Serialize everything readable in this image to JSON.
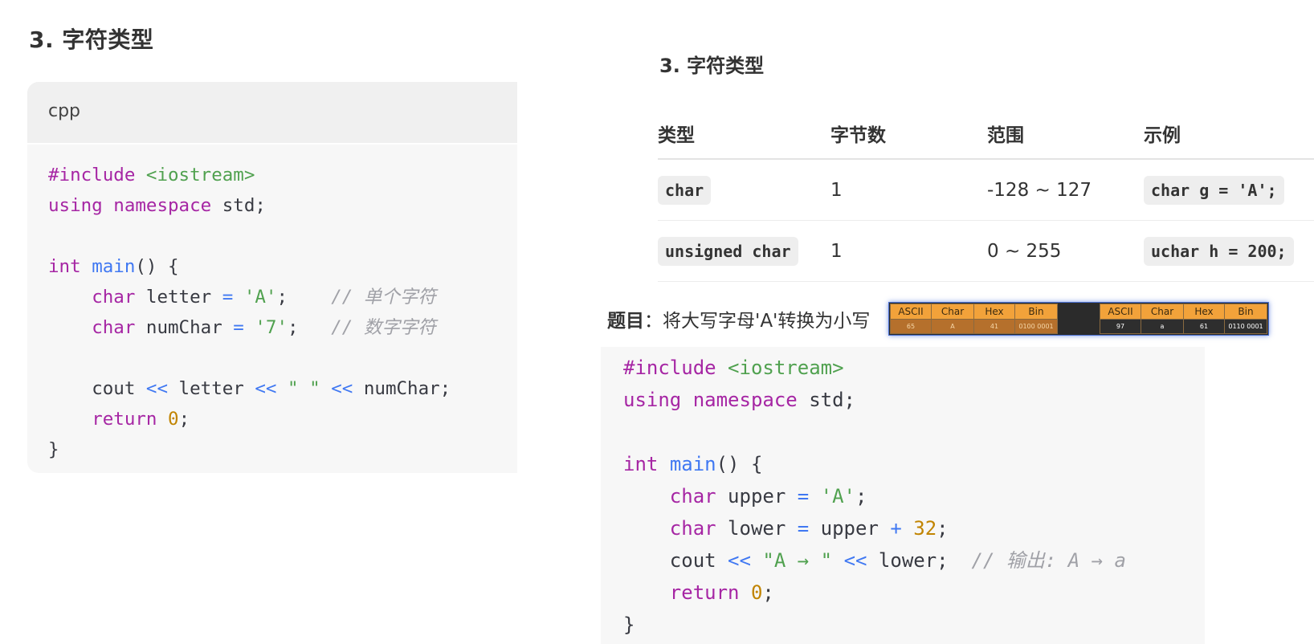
{
  "left": {
    "heading": "3. 字符类型",
    "code_lang": "cpp",
    "code": {
      "l1_directive": "#include",
      "l1_header": " <iostream>",
      "l2_kw1": "using",
      "l2_kw2": "namespace",
      "l2_rest": " std;",
      "l4_kw": "int",
      "l4_fn": "main",
      "l4_rest": "() {",
      "l5_indent": "    ",
      "l5_kw": "char",
      "l5_var": " letter ",
      "l5_op": "=",
      "l5_str": "'A'",
      "l5_semi": ";    ",
      "l5_comment": "// 单个字符",
      "l6_indent": "    ",
      "l6_kw": "char",
      "l6_var": " numChar ",
      "l6_op": "=",
      "l6_str": "'7'",
      "l6_semi": ";   ",
      "l6_comment": "// 数字字符",
      "l8_indent": "    ",
      "l8_cout": "cout ",
      "l8_op1": "<<",
      "l8_var": " letter ",
      "l8_op2": "<<",
      "l8_str": "\" \"",
      "l8_op3": "<<",
      "l8_rest": " numChar;",
      "l9_indent": "    ",
      "l9_kw": "return",
      "l9_num": "0",
      "l9_semi": ";",
      "l10": "}"
    }
  },
  "right": {
    "heading": "3. 字符类型",
    "table": {
      "headers": [
        "类型",
        "字节数",
        "范围",
        "示例"
      ],
      "rows": [
        {
          "type": "char",
          "bytes": "1",
          "range": "-128 ~ 127",
          "example": "char g = 'A';"
        },
        {
          "type": "unsigned char",
          "bytes": "1",
          "range": "0 ~ 255",
          "example": "uchar h = 200;"
        }
      ]
    },
    "task": {
      "label": "题目",
      "text": "：将大写字母'A'转换为小写"
    },
    "ascii_popup": {
      "headers": [
        "ASCII",
        "Char",
        "Hex",
        "Bin"
      ],
      "left_values": [
        "65",
        "A",
        "41",
        "0100 0001"
      ],
      "right_values": [
        "97",
        "a",
        "61",
        "0110 0001"
      ]
    },
    "code": {
      "l1_directive": "#include",
      "l1_header": " <iostream>",
      "l2_kw1": "using",
      "l2_kw2": "namespace",
      "l2_rest": " std;",
      "l4_kw": "int",
      "l4_fn": "main",
      "l4_rest": "() {",
      "l5_indent": "    ",
      "l5_kw": "char",
      "l5_var": " upper ",
      "l5_op": "=",
      "l5_str": "'A'",
      "l5_semi": ";",
      "l6_indent": "    ",
      "l6_kw": "char",
      "l6_var": " lower ",
      "l6_op": "=",
      "l6_var2": " upper ",
      "l6_op2": "+",
      "l6_num": "32",
      "l6_semi": ";",
      "l7_indent": "    ",
      "l7_cout": "cout ",
      "l7_op1": "<<",
      "l7_str": "\"A → \"",
      "l7_op2": "<<",
      "l7_rest": " lower;  ",
      "l7_comment": "// 输出: A → a",
      "l8_indent": "    ",
      "l8_kw": "return",
      "l8_num": "0",
      "l8_semi": ";",
      "l9": "}"
    }
  }
}
